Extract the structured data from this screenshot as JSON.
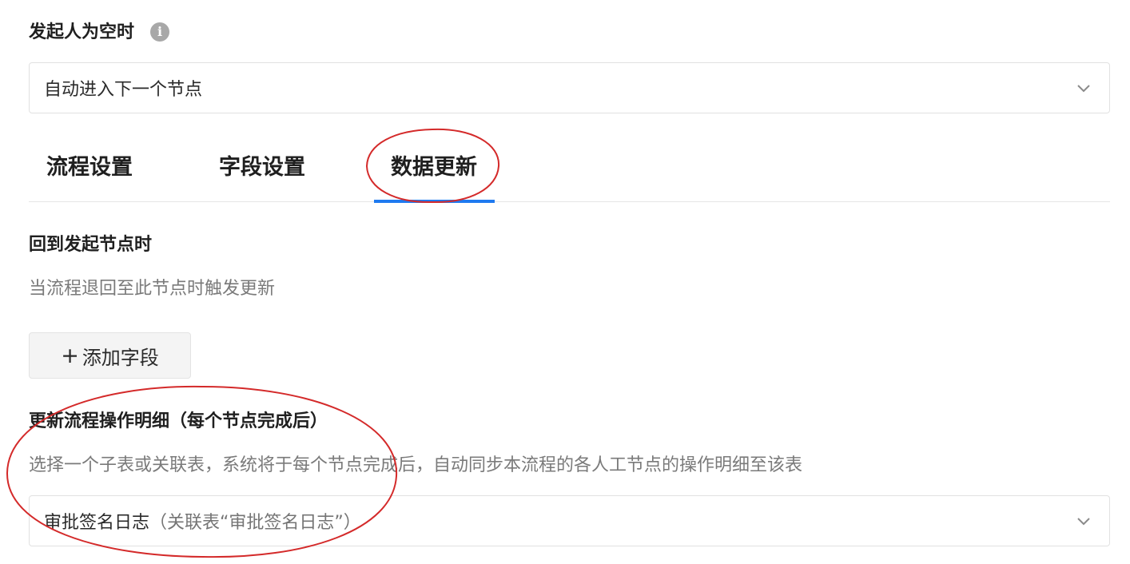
{
  "initiator_section": {
    "title": "发起人为空时",
    "info_icon": "info-icon",
    "select_value": "自动进入下一个节点",
    "select_icon": "chevron-down-icon"
  },
  "tabs": [
    {
      "label": "流程设置",
      "active": false
    },
    {
      "label": "字段设置",
      "active": false
    },
    {
      "label": "数据更新",
      "active": true
    }
  ],
  "return_section": {
    "title": "回到发起节点时",
    "description": "当流程退回至此节点时触发更新",
    "add_button": {
      "icon": "+",
      "label": "添加字段"
    }
  },
  "detail_section": {
    "title": "更新流程操作明细（每个节点完成后）",
    "description": "选择一个子表或关联表，系统将于每个节点完成后，自动同步本流程的各人工节点的操作明细至该表",
    "select_value": "审批签名日志",
    "select_value_note": "（关联表“审批签名日志”）",
    "select_icon": "chevron-down-icon"
  },
  "colors": {
    "accent": "#1f7af0",
    "annotation": "#d42a2a"
  }
}
